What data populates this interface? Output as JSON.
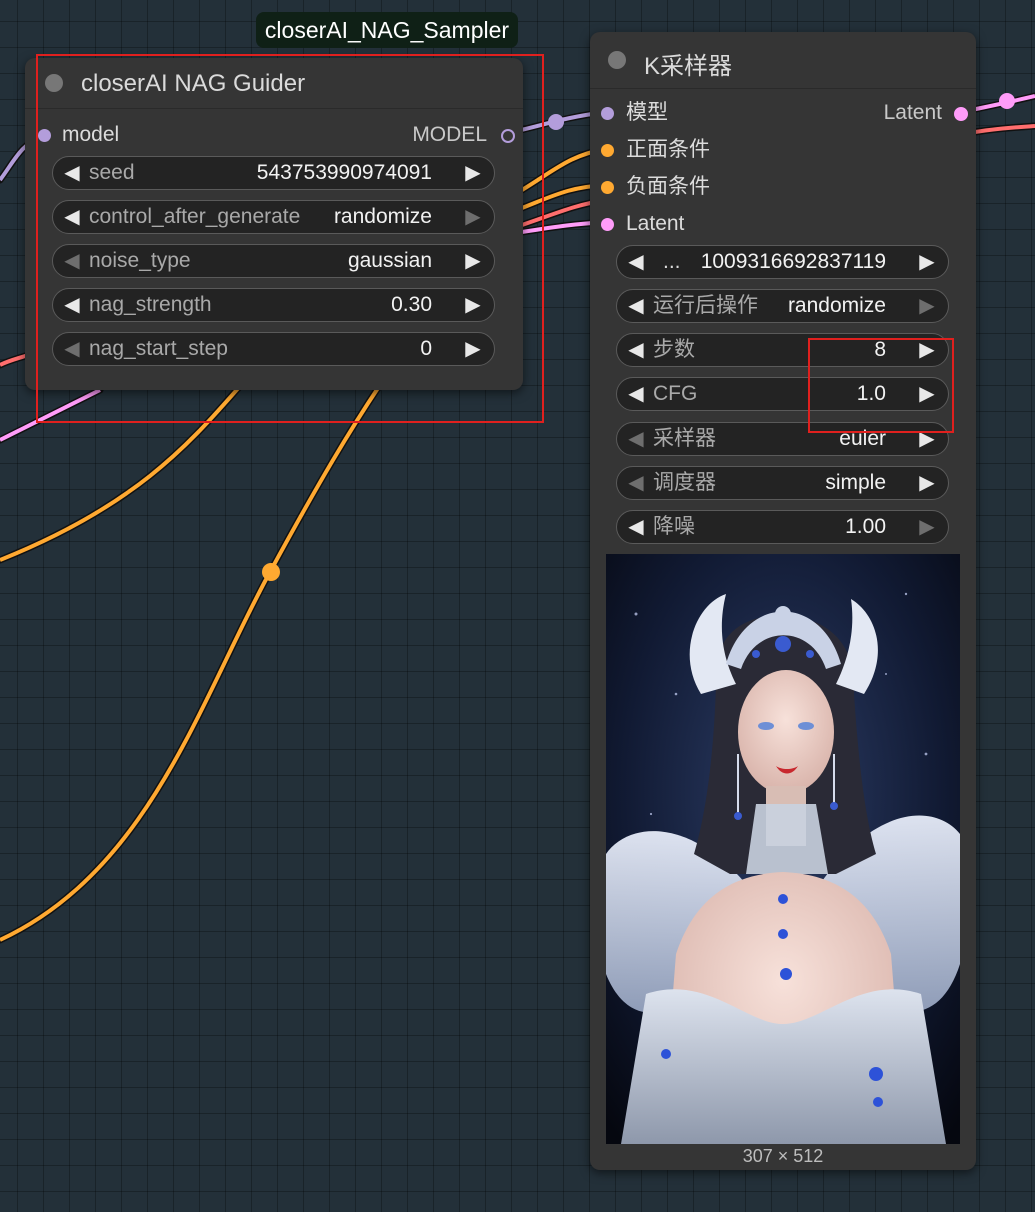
{
  "group": {
    "title": "closerAI_NAG_Sampler"
  },
  "nag_guider": {
    "title": "closerAI NAG Guider",
    "input": {
      "label": "model"
    },
    "output": {
      "label": "MODEL"
    },
    "widgets": [
      {
        "label": "seed",
        "value": "543753990974091"
      },
      {
        "label": "control_after_generate",
        "value": "randomize"
      },
      {
        "label": "noise_type",
        "value": "gaussian"
      },
      {
        "label": "nag_strength",
        "value": "0.30"
      },
      {
        "label": "nag_start_step",
        "value": "0"
      }
    ]
  },
  "ksampler": {
    "title": "K采样器",
    "inputs": [
      {
        "label": "模型",
        "color": "#b39ddb"
      },
      {
        "label": "正面条件",
        "color": "#ffa931"
      },
      {
        "label": "负面条件",
        "color": "#ffa931"
      },
      {
        "label": "Latent",
        "color": "#ff9cf9"
      }
    ],
    "output": {
      "label": "Latent",
      "color": "#ff9cf9"
    },
    "widgets": [
      {
        "label": "...",
        "value": "1009316692837119"
      },
      {
        "label": "运行后操作",
        "value": "randomize"
      },
      {
        "label": "步数",
        "value": "8"
      },
      {
        "label": "CFG",
        "value": "1.0"
      },
      {
        "label": "采样器",
        "value": "euler"
      },
      {
        "label": "调度器",
        "value": "simple"
      },
      {
        "label": "降噪",
        "value": "1.00"
      }
    ],
    "preview": {
      "size_caption": "307 × 512"
    }
  },
  "colors": {
    "model": "#b39ddb",
    "conditioning": "#ffa931",
    "latent": "#ff9cf9",
    "red_link": "#ff6e6e",
    "highlight": "#e0201e"
  }
}
